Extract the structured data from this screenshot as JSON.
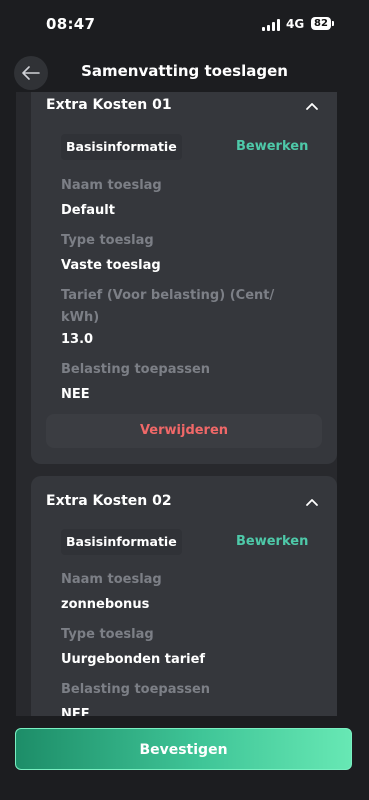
{
  "status": {
    "time": "08:47",
    "network": "4G",
    "battery": "82"
  },
  "header": {
    "title": "Samenvatting toeslagen"
  },
  "cards": [
    {
      "title": "Extra Kosten 01",
      "section": "Basisinformatie",
      "edit": "Bewerken",
      "fields": [
        {
          "label": "Naam toeslag",
          "value": "Default"
        },
        {
          "label": "Type toeslag",
          "value": "Vaste toeslag"
        },
        {
          "label": "Tarief (Voor belasting) (Cent/ kWh)",
          "value": "13.0"
        },
        {
          "label": "Belasting toepassen",
          "value": "NEE"
        }
      ],
      "delete": "Verwijderen"
    },
    {
      "title": "Extra Kosten 02",
      "section": "Basisinformatie",
      "edit": "Bewerken",
      "fields": [
        {
          "label": "Naam toeslag",
          "value": "zonnebonus"
        },
        {
          "label": "Type toeslag",
          "value": "Uurgebonden tarief"
        },
        {
          "label": "Belasting toepassen",
          "value": "NEE"
        }
      ]
    }
  ],
  "footer": {
    "confirm": "Bevestigen"
  }
}
